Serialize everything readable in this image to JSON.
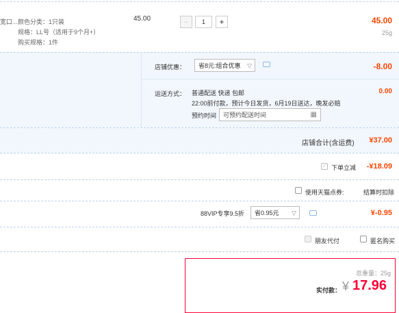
{
  "item": {
    "name_fragment": "宽口...",
    "attrs": [
      "颜色分类：1只装",
      "规格：LL号（适用于9个月+）",
      "购买规格：1件"
    ],
    "unit_price": "45.00",
    "quantity": "1",
    "minus": "−",
    "plus": "+",
    "subtotal": "45.00",
    "weight": "25g"
  },
  "store_discount": {
    "label": "店铺优惠：",
    "select_value": "省8元:组合优惠",
    "amount": "-8.00"
  },
  "shipping": {
    "label": "运送方式：",
    "line1": "普通配送 快递 包邮",
    "line2": "22:00前付款，预计今日发货，6月19日送达，晚发必赔",
    "time_label": "预约时间",
    "time_placeholder": "可预约配送时间",
    "amount": "0.00"
  },
  "store_total": {
    "label": "店铺合计(含运费)",
    "amount": "¥37.00"
  },
  "order_discount": {
    "label": "下单立减",
    "amount": "-¥18.09",
    "checked": true
  },
  "tmall_points": {
    "label": "使用天猫点券:",
    "note": "结算时扣除"
  },
  "vip": {
    "label": "88VIP专享9.5折",
    "select_value": "省0.95元",
    "amount": "¥-0.95"
  },
  "options": {
    "friend_pay": "朋友代付",
    "anonymous": "匿名购买"
  },
  "summary": {
    "total_weight": "总重量：25g",
    "pay_label": "实付款：",
    "currency": "¥",
    "pay_amount": "17.96"
  },
  "colors": {
    "accent": "#ff4400",
    "pay_red": "#ff0036",
    "band": "#f2f7fd"
  }
}
